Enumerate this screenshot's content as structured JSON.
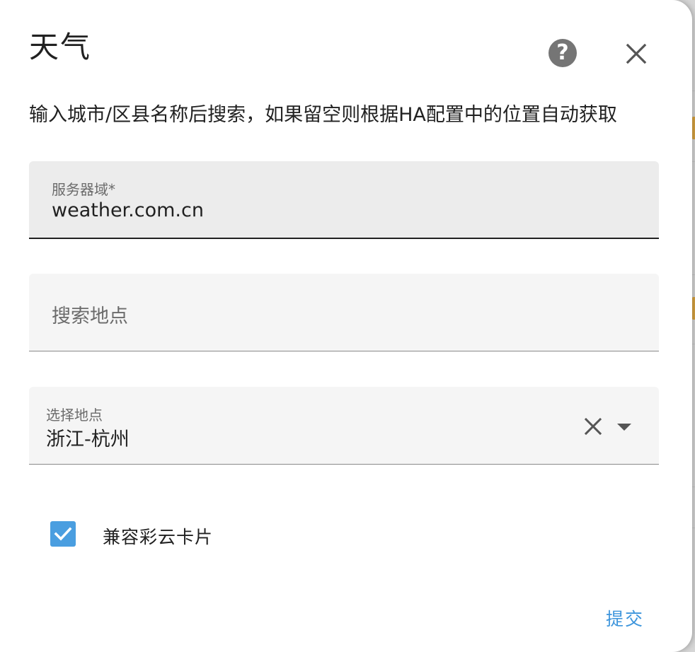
{
  "dialog": {
    "title": "天气",
    "help_icon": "help-circle-icon",
    "help_glyph": "?",
    "close_icon": "close-icon",
    "description": "输入城市/区县名称后搜索，如果留空则根据HA配置中的位置自动获取"
  },
  "fields": {
    "server_domain": {
      "label": "服务器域*",
      "value": "weather.com.cn"
    },
    "search_location": {
      "placeholder": "搜索地点"
    },
    "select_location": {
      "label": "选择地点",
      "value": "浙江-杭州",
      "clear_icon": "close-icon",
      "dropdown_icon": "menu-down-icon"
    }
  },
  "compat_checkbox": {
    "checked": true,
    "label": "兼容彩云卡片",
    "icon": "check-icon"
  },
  "actions": {
    "submit_label": "提交"
  },
  "colors": {
    "accent": "#4a9ee0",
    "submit_text": "#3d95dc",
    "help_icon_bg": "#757575",
    "background_accent": "#d9a441"
  }
}
